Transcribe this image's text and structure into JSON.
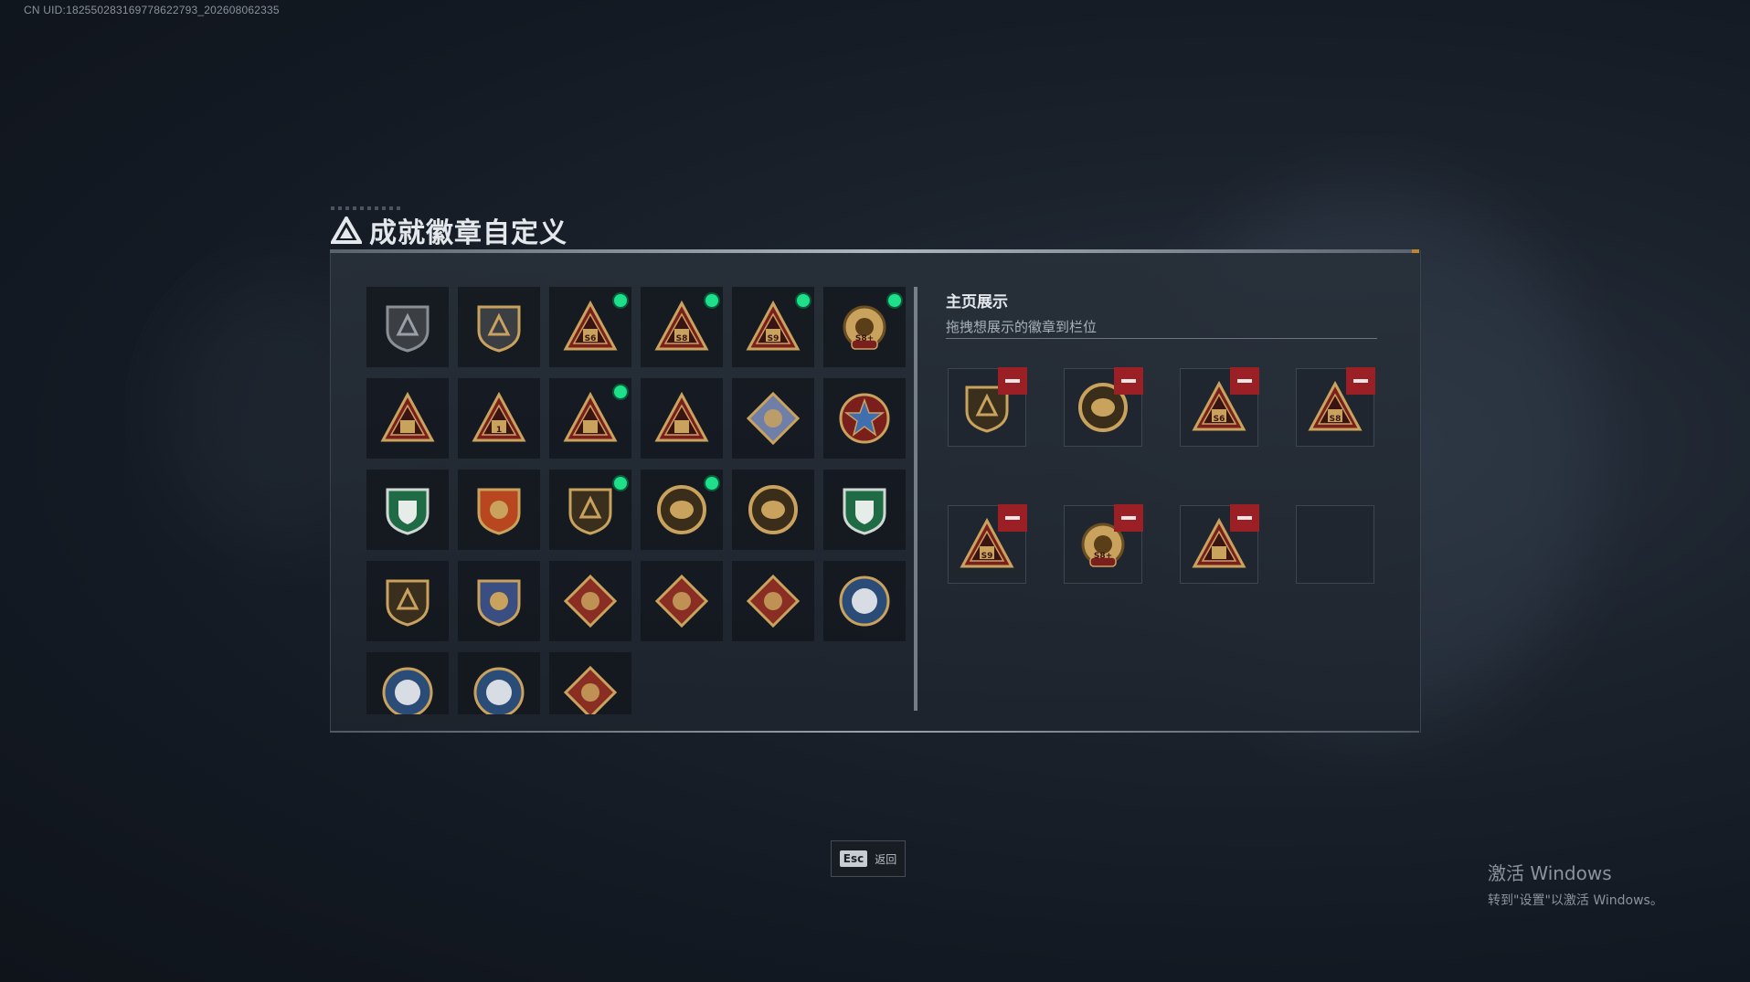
{
  "header": {
    "uid_text": "CN UID:182550283169778622793_202608062335",
    "title": "成就徽章自定义"
  },
  "colors": {
    "gold": "#c9a25e",
    "badge_red": "#7a1f1c",
    "new_dot": "#1fe08a",
    "remove_button": "#9a2026"
  },
  "badge_grid": [
    {
      "icon": "delta-shield-badge-icon",
      "new": false
    },
    {
      "icon": "helicopter-shield-badge-icon",
      "new": false
    },
    {
      "icon": "s6-triangle-badge-icon",
      "new": true,
      "text": "S6"
    },
    {
      "icon": "s8-triangle-badge-icon",
      "new": true,
      "text": "S8"
    },
    {
      "icon": "s9-figure-triangle-badge-icon",
      "new": true,
      "text": "S9"
    },
    {
      "icon": "s8-gear-badge-icon",
      "new": true,
      "text": "S8+"
    },
    {
      "icon": "bird-triangle-badge-icon",
      "new": false
    },
    {
      "icon": "number-one-triangle-badge-icon",
      "new": false,
      "text": "1"
    },
    {
      "icon": "crate-triangle-badge-icon",
      "new": true
    },
    {
      "icon": "soldiers-triangle-badge-icon",
      "new": false
    },
    {
      "icon": "crystal-diamond-badge-icon",
      "new": false
    },
    {
      "icon": "star-medal-badge-icon",
      "new": false
    },
    {
      "icon": "green-shield-badge-icon",
      "new": false
    },
    {
      "icon": "orange-crest-badge-icon",
      "new": false
    },
    {
      "icon": "gem-shield-badge-icon",
      "new": true
    },
    {
      "icon": "pearl-ring-badge-icon",
      "new": true
    },
    {
      "icon": "eye-ring-badge-icon",
      "new": false
    },
    {
      "icon": "green-rifle-badge-icon",
      "new": false
    },
    {
      "icon": "rifle-shield-badge-icon",
      "new": false
    },
    {
      "icon": "crossed-swords-badge-icon",
      "new": false
    },
    {
      "icon": "wolf-diamond-badge-icon",
      "new": false
    },
    {
      "icon": "dragon-diamond-badge-icon",
      "new": false
    },
    {
      "icon": "runner-diamond-badge-icon",
      "new": false
    },
    {
      "icon": "wolf-blue-circle-badge-icon",
      "new": false
    },
    {
      "icon": "wolf-blue-circle-2-badge-icon",
      "new": false
    },
    {
      "icon": "globe-blue-circle-badge-icon",
      "new": false
    },
    {
      "icon": "wheel-diamond-badge-icon",
      "new": false
    }
  ],
  "showcase": {
    "title": "主页展示",
    "subtitle": "拖拽想展示的徽章到栏位",
    "slots": [
      {
        "icon": "gem-shield-badge-icon",
        "filled": true
      },
      {
        "icon": "pearl-ring-badge-icon",
        "filled": true
      },
      {
        "icon": "s6-triangle-badge-icon",
        "filled": true,
        "text": "S6"
      },
      {
        "icon": "s8-triangle-badge-icon",
        "filled": true,
        "text": "S8"
      },
      {
        "icon": "s9-figure-triangle-badge-icon",
        "filled": true,
        "text": "S9"
      },
      {
        "icon": "s8-gear-badge-icon",
        "filled": true,
        "text": "S8+"
      },
      {
        "icon": "crate-triangle-badge-icon",
        "filled": true
      },
      {
        "icon": "empty-slot",
        "filled": false
      }
    ]
  },
  "footer": {
    "esc_key": "Esc",
    "esc_label": "返回"
  },
  "watermark": {
    "line1": "激活 Windows",
    "line2": "转到\"设置\"以激活 Windows。"
  }
}
